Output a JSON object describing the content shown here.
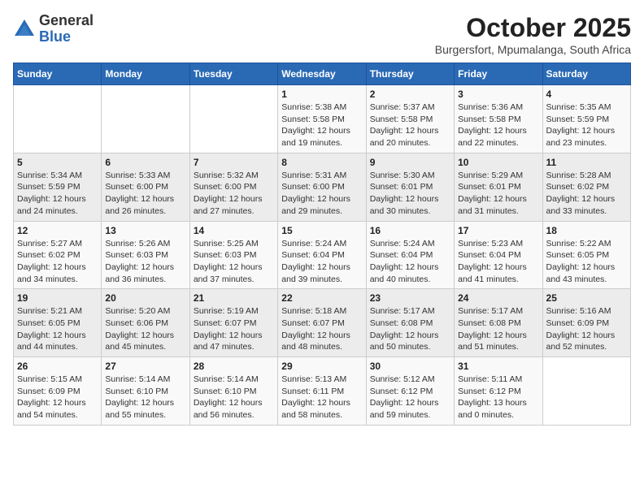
{
  "header": {
    "logo_general": "General",
    "logo_blue": "Blue",
    "month": "October 2025",
    "location": "Burgersfort, Mpumalanga, South Africa"
  },
  "days_of_week": [
    "Sunday",
    "Monday",
    "Tuesday",
    "Wednesday",
    "Thursday",
    "Friday",
    "Saturday"
  ],
  "weeks": [
    [
      {
        "day": "",
        "info": ""
      },
      {
        "day": "",
        "info": ""
      },
      {
        "day": "",
        "info": ""
      },
      {
        "day": "1",
        "info": "Sunrise: 5:38 AM\nSunset: 5:58 PM\nDaylight: 12 hours and 19 minutes."
      },
      {
        "day": "2",
        "info": "Sunrise: 5:37 AM\nSunset: 5:58 PM\nDaylight: 12 hours and 20 minutes."
      },
      {
        "day": "3",
        "info": "Sunrise: 5:36 AM\nSunset: 5:58 PM\nDaylight: 12 hours and 22 minutes."
      },
      {
        "day": "4",
        "info": "Sunrise: 5:35 AM\nSunset: 5:59 PM\nDaylight: 12 hours and 23 minutes."
      }
    ],
    [
      {
        "day": "5",
        "info": "Sunrise: 5:34 AM\nSunset: 5:59 PM\nDaylight: 12 hours and 24 minutes."
      },
      {
        "day": "6",
        "info": "Sunrise: 5:33 AM\nSunset: 6:00 PM\nDaylight: 12 hours and 26 minutes."
      },
      {
        "day": "7",
        "info": "Sunrise: 5:32 AM\nSunset: 6:00 PM\nDaylight: 12 hours and 27 minutes."
      },
      {
        "day": "8",
        "info": "Sunrise: 5:31 AM\nSunset: 6:00 PM\nDaylight: 12 hours and 29 minutes."
      },
      {
        "day": "9",
        "info": "Sunrise: 5:30 AM\nSunset: 6:01 PM\nDaylight: 12 hours and 30 minutes."
      },
      {
        "day": "10",
        "info": "Sunrise: 5:29 AM\nSunset: 6:01 PM\nDaylight: 12 hours and 31 minutes."
      },
      {
        "day": "11",
        "info": "Sunrise: 5:28 AM\nSunset: 6:02 PM\nDaylight: 12 hours and 33 minutes."
      }
    ],
    [
      {
        "day": "12",
        "info": "Sunrise: 5:27 AM\nSunset: 6:02 PM\nDaylight: 12 hours and 34 minutes."
      },
      {
        "day": "13",
        "info": "Sunrise: 5:26 AM\nSunset: 6:03 PM\nDaylight: 12 hours and 36 minutes."
      },
      {
        "day": "14",
        "info": "Sunrise: 5:25 AM\nSunset: 6:03 PM\nDaylight: 12 hours and 37 minutes."
      },
      {
        "day": "15",
        "info": "Sunrise: 5:24 AM\nSunset: 6:04 PM\nDaylight: 12 hours and 39 minutes."
      },
      {
        "day": "16",
        "info": "Sunrise: 5:24 AM\nSunset: 6:04 PM\nDaylight: 12 hours and 40 minutes."
      },
      {
        "day": "17",
        "info": "Sunrise: 5:23 AM\nSunset: 6:04 PM\nDaylight: 12 hours and 41 minutes."
      },
      {
        "day": "18",
        "info": "Sunrise: 5:22 AM\nSunset: 6:05 PM\nDaylight: 12 hours and 43 minutes."
      }
    ],
    [
      {
        "day": "19",
        "info": "Sunrise: 5:21 AM\nSunset: 6:05 PM\nDaylight: 12 hours and 44 minutes."
      },
      {
        "day": "20",
        "info": "Sunrise: 5:20 AM\nSunset: 6:06 PM\nDaylight: 12 hours and 45 minutes."
      },
      {
        "day": "21",
        "info": "Sunrise: 5:19 AM\nSunset: 6:07 PM\nDaylight: 12 hours and 47 minutes."
      },
      {
        "day": "22",
        "info": "Sunrise: 5:18 AM\nSunset: 6:07 PM\nDaylight: 12 hours and 48 minutes."
      },
      {
        "day": "23",
        "info": "Sunrise: 5:17 AM\nSunset: 6:08 PM\nDaylight: 12 hours and 50 minutes."
      },
      {
        "day": "24",
        "info": "Sunrise: 5:17 AM\nSunset: 6:08 PM\nDaylight: 12 hours and 51 minutes."
      },
      {
        "day": "25",
        "info": "Sunrise: 5:16 AM\nSunset: 6:09 PM\nDaylight: 12 hours and 52 minutes."
      }
    ],
    [
      {
        "day": "26",
        "info": "Sunrise: 5:15 AM\nSunset: 6:09 PM\nDaylight: 12 hours and 54 minutes."
      },
      {
        "day": "27",
        "info": "Sunrise: 5:14 AM\nSunset: 6:10 PM\nDaylight: 12 hours and 55 minutes."
      },
      {
        "day": "28",
        "info": "Sunrise: 5:14 AM\nSunset: 6:10 PM\nDaylight: 12 hours and 56 minutes."
      },
      {
        "day": "29",
        "info": "Sunrise: 5:13 AM\nSunset: 6:11 PM\nDaylight: 12 hours and 58 minutes."
      },
      {
        "day": "30",
        "info": "Sunrise: 5:12 AM\nSunset: 6:12 PM\nDaylight: 12 hours and 59 minutes."
      },
      {
        "day": "31",
        "info": "Sunrise: 5:11 AM\nSunset: 6:12 PM\nDaylight: 13 hours and 0 minutes."
      },
      {
        "day": "",
        "info": ""
      }
    ]
  ]
}
